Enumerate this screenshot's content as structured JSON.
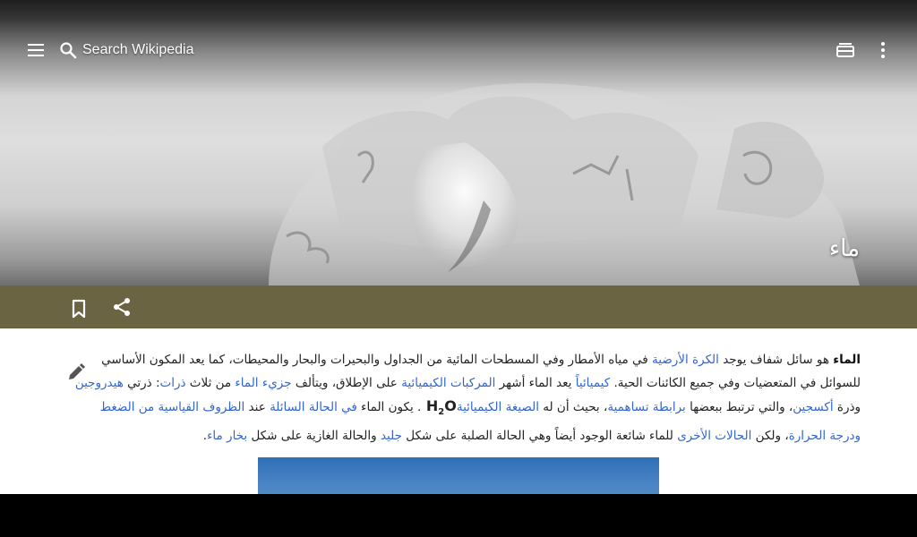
{
  "colors": {
    "progress": "#1aa587",
    "action_bar": "#6a6442",
    "link": "#3366cc",
    "text": "#222222",
    "nav_bar": "#000000"
  },
  "toolbar": {
    "menu_icon": "hamburger-menu-icon",
    "search_icon": "magnifier-icon",
    "search_placeholder": "Search Wikipedia",
    "tabs_icon": "tabs-icon",
    "overflow_icon": "vertical-dots-icon"
  },
  "page": {
    "title": "ماء"
  },
  "actions": {
    "bookmark_icon": "bookmark-icon",
    "share_icon": "share-icon",
    "edit_icon": "pencil-icon"
  },
  "article": {
    "lead": {
      "t01": "الماء",
      "t02": " هو سائل شفاف يوجد في مياه الأمطار وفي المسطحات المائية من الجداول والبحيرات والبحار والمحيطات، كما يعد المكون الأساسي للسوائل في المتعضيات وفي جميع الكائنات الحية. ",
      "t03": "كيميائياً",
      "t04": " يعد الماء أشهر ",
      "t05": "المركبات الكيميائية",
      "t06": " على الإطلاق، ويتألف ",
      "t07": "جزيء الماء",
      "t08": " من ثلاث ",
      "t09": "ذرات",
      "t10": ": ذرتي ",
      "t11": "هيدروجين",
      "t12": " وذرة ",
      "t13": "أكسجين",
      "t14": "، والتي ترتبط ببعضها ",
      "t15": "برابطة تساهمية",
      "t16": "، بحيث أن له ",
      "t17": "الصيغة الكيميائية",
      "t18": " H",
      "t19": "2",
      "t20": "O",
      "t21": ". يكون الماء ",
      "t22": "في الحالة السائلة",
      "t23": " عند ",
      "t24": "الظروف القياسية من الضغط ودرجة الحرارة",
      "t25": "، ولكن ",
      "t26": "الحالات الأخرى",
      "t27": " للماء شائعة الوجود أيضاً وهي الحالة الصلبة على شكل ",
      "t28": "جليد",
      "t29": " والحالة الغازية على شكل ",
      "t30": "بخار ماء",
      "t31": ".",
      "link_10": "الكرة الأرضية"
    }
  }
}
